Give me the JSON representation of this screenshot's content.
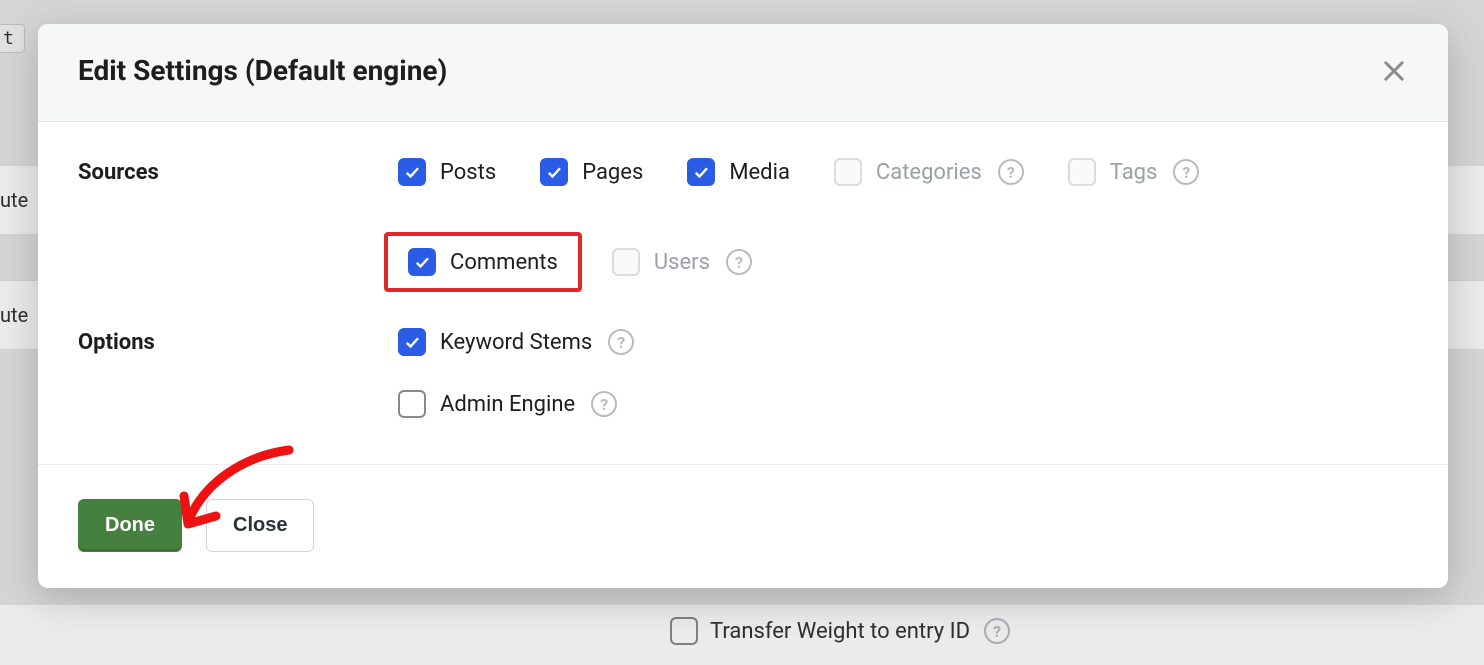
{
  "modal": {
    "title": "Edit Settings (Default engine)"
  },
  "groups": {
    "sources": {
      "label": "Sources",
      "items": {
        "posts": {
          "label": "Posts",
          "checked": true,
          "disabled": false,
          "help": false
        },
        "pages": {
          "label": "Pages",
          "checked": true,
          "disabled": false,
          "help": false
        },
        "media": {
          "label": "Media",
          "checked": true,
          "disabled": false,
          "help": false
        },
        "categories": {
          "label": "Categories",
          "checked": false,
          "disabled": true,
          "help": true
        },
        "tags": {
          "label": "Tags",
          "checked": false,
          "disabled": true,
          "help": true
        },
        "comments": {
          "label": "Comments",
          "checked": true,
          "disabled": false,
          "help": false
        },
        "users": {
          "label": "Users",
          "checked": false,
          "disabled": true,
          "help": true
        }
      }
    },
    "options": {
      "label": "Options",
      "items": {
        "keyword_stems": {
          "label": "Keyword Stems",
          "checked": true,
          "disabled": false,
          "help": true
        },
        "admin_engine": {
          "label": "Admin Engine",
          "checked": false,
          "disabled": false,
          "help": true
        }
      }
    }
  },
  "footer": {
    "done": "Done",
    "close": "Close"
  },
  "background": {
    "row1": "ute",
    "row2": "ute",
    "tag": "t",
    "bottom_option": "Transfer Weight to entry ID"
  }
}
